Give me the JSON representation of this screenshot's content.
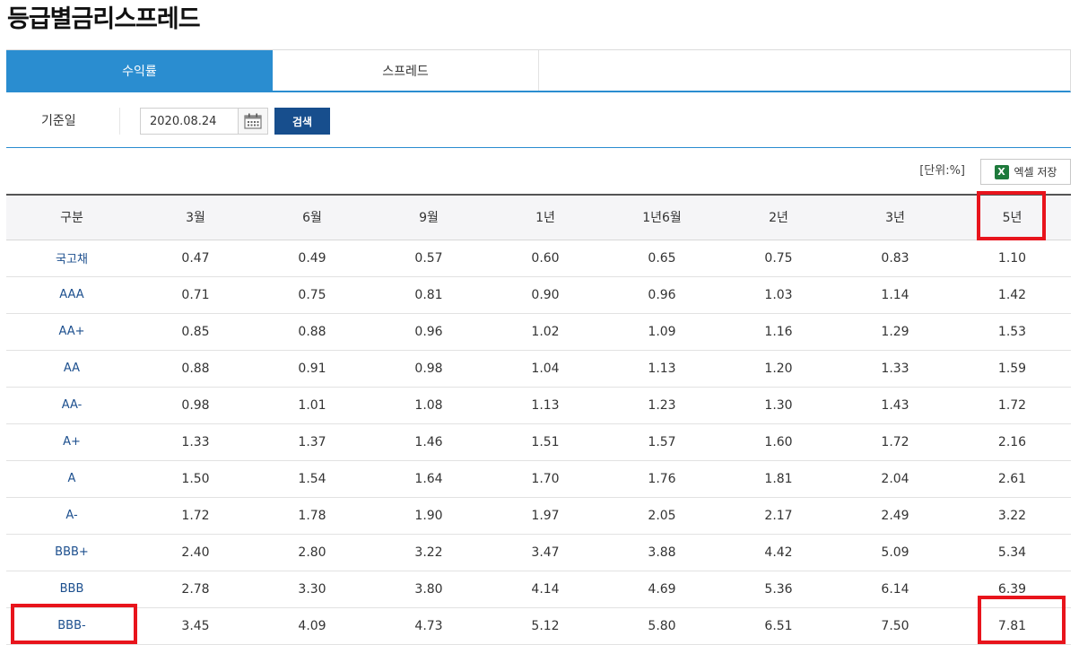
{
  "page": {
    "title": "등급별금리스프레드"
  },
  "tabs": [
    {
      "label": "수익률",
      "active": true
    },
    {
      "label": "스프레드",
      "active": false
    }
  ],
  "filter": {
    "label": "기준일",
    "date_value": "2020.08.24",
    "search_label": "검색"
  },
  "toolbar": {
    "unit": "[단위:%]",
    "excel_label": "엑셀 저장",
    "excel_icon_letter": "X"
  },
  "table": {
    "columns": [
      "구분",
      "3월",
      "6월",
      "9월",
      "1년",
      "1년6월",
      "2년",
      "3년",
      "5년"
    ],
    "rows": [
      {
        "grade": "국고채",
        "values": [
          "0.47",
          "0.49",
          "0.57",
          "0.60",
          "0.65",
          "0.75",
          "0.83",
          "1.10"
        ]
      },
      {
        "grade": "AAA",
        "values": [
          "0.71",
          "0.75",
          "0.81",
          "0.90",
          "0.96",
          "1.03",
          "1.14",
          "1.42"
        ]
      },
      {
        "grade": "AA+",
        "values": [
          "0.85",
          "0.88",
          "0.96",
          "1.02",
          "1.09",
          "1.16",
          "1.29",
          "1.53"
        ]
      },
      {
        "grade": "AA",
        "values": [
          "0.88",
          "0.91",
          "0.98",
          "1.04",
          "1.13",
          "1.20",
          "1.33",
          "1.59"
        ]
      },
      {
        "grade": "AA-",
        "values": [
          "0.98",
          "1.01",
          "1.08",
          "1.13",
          "1.23",
          "1.30",
          "1.43",
          "1.72"
        ]
      },
      {
        "grade": "A+",
        "values": [
          "1.33",
          "1.37",
          "1.46",
          "1.51",
          "1.57",
          "1.60",
          "1.72",
          "2.16"
        ]
      },
      {
        "grade": "A",
        "values": [
          "1.50",
          "1.54",
          "1.64",
          "1.70",
          "1.76",
          "1.81",
          "2.04",
          "2.61"
        ]
      },
      {
        "grade": "A-",
        "values": [
          "1.72",
          "1.78",
          "1.90",
          "1.97",
          "2.05",
          "2.17",
          "2.49",
          "3.22"
        ]
      },
      {
        "grade": "BBB+",
        "values": [
          "2.40",
          "2.80",
          "3.22",
          "3.47",
          "3.88",
          "4.42",
          "5.09",
          "5.34"
        ]
      },
      {
        "grade": "BBB",
        "values": [
          "2.78",
          "3.30",
          "3.80",
          "4.14",
          "4.69",
          "5.36",
          "6.14",
          "6.39"
        ]
      },
      {
        "grade": "BBB-",
        "values": [
          "3.45",
          "4.09",
          "4.73",
          "5.12",
          "5.80",
          "6.51",
          "7.50",
          "7.81"
        ]
      }
    ]
  },
  "colors": {
    "accent": "#2a8dd0",
    "search_button": "#174e8d",
    "grade_text": "#1c4f8e",
    "highlight": "#e8141c"
  }
}
